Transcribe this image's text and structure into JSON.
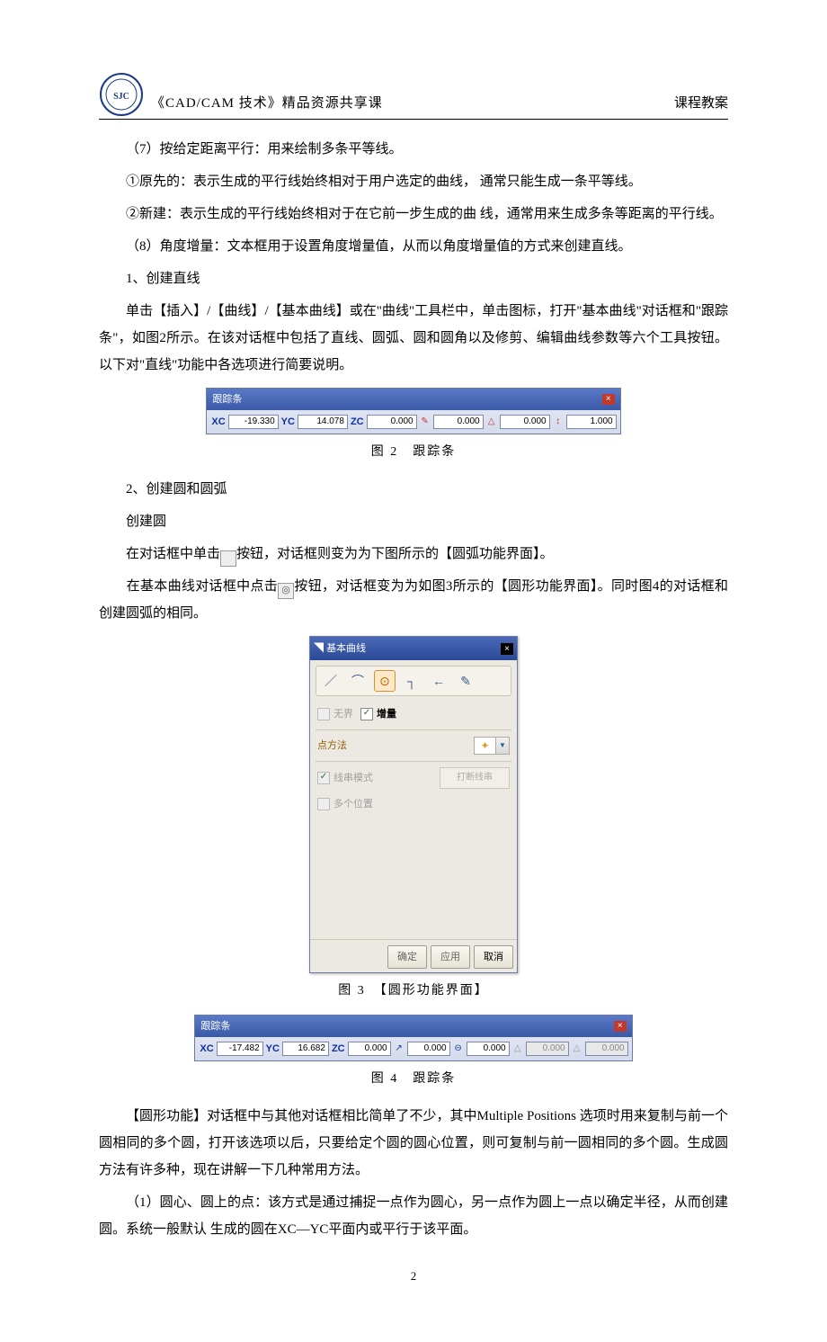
{
  "header": {
    "title": "《CAD/CAM 技术》精品资源共享课",
    "right": "课程教案"
  },
  "paragraphs": {
    "p1": "（7）按给定距离平行：用来绘制多条平等线。",
    "p2": "①原先的：表示生成的平行线始终相对于用户选定的曲线， 通常只能生成一条平等线。",
    "p3": "②新建：表示生成的平行线始终相对于在它前一步生成的曲 线，通常用来生成多条等距离的平行线。",
    "p4": "（8）角度增量：文本框用于设置角度增量值，从而以角度增量值的方式来创建直线。",
    "p5": "1、创建直线",
    "p6": "单击【插入】/【曲线】/【基本曲线】或在\"曲线\"工具栏中，单击图标，打开\"基本曲线\"对话框和\"跟踪条\"，如图2所示。在该对话框中包括了直线、圆弧、圆和圆角以及修剪、编辑曲线参数等六个工具按钮。以下对\"直线\"功能中各选项进行简要说明。",
    "p7": "2、创建圆和圆弧",
    "p8": "创建圆",
    "p9a": "在对话框中单击",
    "p9b": "按钮，对话框则变为为下图所示的【圆弧功能界面】。",
    "p10a": "在基本曲线对话框中点击",
    "p10b": "按钮，对话框变为为如图3所示的【圆形功能界面】。同时图4的对话框和创建圆弧的相同。",
    "p11": "【圆形功能】对话框中与其他对话框相比简单了不少，其中Multiple Positions 选项时用来复制与前一个圆相同的多个圆，打开该选项以后，只要给定个圆的圆心位置，则可复制与前一圆相同的多个圆。生成圆方法有许多种，现在讲解一下几种常用方法。",
    "p12": "（1）圆心、圆上的点：该方式是通过捕捉一点作为圆心，另一点作为圆上一点以确定半径，从而创建圆。系统一般默认 生成的圆在XC—YC平面内或平行于该平面。"
  },
  "fig2": {
    "title": "跟踪条",
    "caption": "图 2　跟踪条",
    "xc_label": "XC",
    "xc_val": "-19.330",
    "yc_label": "YC",
    "yc_val": "14.078",
    "zc_label": "ZC",
    "zc_val": "0.000",
    "len_val": "0.000",
    "ang_val": "0.000",
    "step_val": "1.000"
  },
  "fig3": {
    "title": "基本曲线",
    "caption": "图 3　【圆形功能界面】",
    "opt_unbounded": "无界",
    "opt_increment": "增量",
    "point_method": "点方法",
    "string_mode": "线串模式",
    "break_string": "打断线串",
    "multi_pos": "多个位置",
    "ok": "确定",
    "apply": "应用",
    "cancel": "取消"
  },
  "fig4": {
    "title": "跟踪条",
    "caption": "图 4　跟踪条",
    "xc_label": "XC",
    "xc_val": "-17.482",
    "yc_label": "YC",
    "yc_val": "16.682",
    "zc_label": "ZC",
    "zc_val": "0.000",
    "r1_val": "0.000",
    "d_val": "0.000",
    "g1_val": "0.000",
    "g2_val": "0.000"
  },
  "inline_icons": {
    "arc": "◝",
    "circle": "◎"
  },
  "page_number": "2"
}
